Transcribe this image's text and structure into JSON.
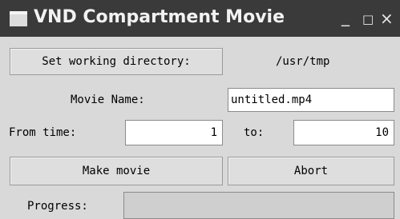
{
  "window": {
    "title": "VND Compartment Movie",
    "controls": {
      "minimize": "_",
      "maximize": "□",
      "close": "×"
    }
  },
  "working_dir": {
    "button_label": "Set working directory:",
    "value": "/usr/tmp"
  },
  "movie_name": {
    "label": "Movie Name:",
    "value": "untitled.mp4"
  },
  "time_range": {
    "from_label": "From time:",
    "from_value": "1",
    "to_label": "to:",
    "to_value": "10"
  },
  "actions": {
    "make_label": "Make movie",
    "abort_label": "Abort"
  },
  "progress": {
    "label": "Progress:",
    "fraction": 0
  }
}
